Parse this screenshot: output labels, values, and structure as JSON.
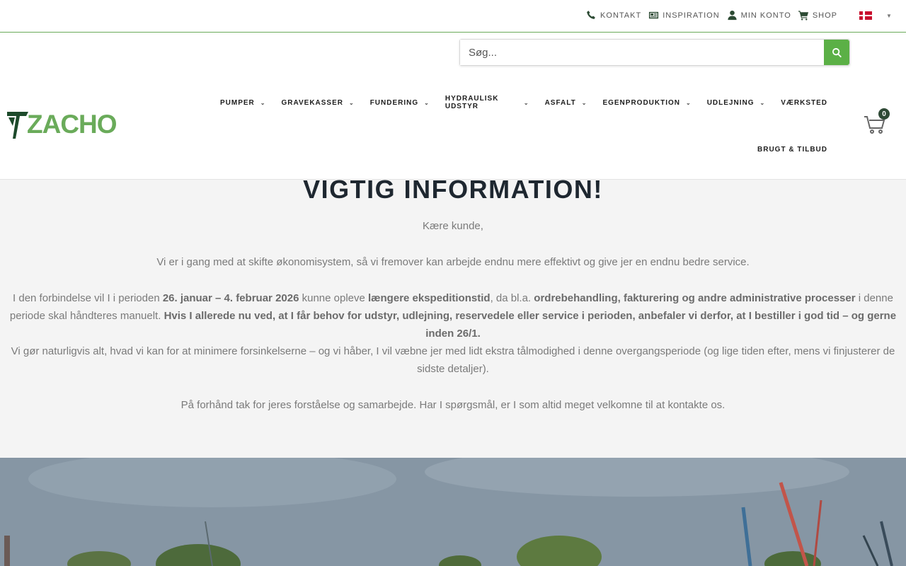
{
  "topbar": {
    "links": [
      {
        "label": "KONTAKT",
        "icon": "phone-icon"
      },
      {
        "label": "INSPIRATION",
        "icon": "newspaper-icon"
      },
      {
        "label": "MIN KONTO",
        "icon": "user-icon"
      },
      {
        "label": "SHOP",
        "icon": "cart-icon"
      }
    ],
    "language": "Danish"
  },
  "search": {
    "placeholder": "Søg..."
  },
  "logo": {
    "text": "ZACHO",
    "color": "#6aab5a"
  },
  "nav": {
    "items": [
      {
        "label": "PUMPER",
        "dropdown": true
      },
      {
        "label": "GRAVEKASSER",
        "dropdown": true
      },
      {
        "label": "FUNDERING",
        "dropdown": true
      },
      {
        "label": "HYDRAULISK UDSTYR",
        "dropdown": true
      },
      {
        "label": "ASFALT",
        "dropdown": true
      },
      {
        "label": "EGENPRODUKTION",
        "dropdown": true
      },
      {
        "label": "UDLEJNING",
        "dropdown": true
      },
      {
        "label": "VÆRKSTED",
        "dropdown": false
      },
      {
        "label": "BRUGT & TILBUD",
        "dropdown": false
      }
    ]
  },
  "cart": {
    "count": "0"
  },
  "notice": {
    "title": "VIGTIG INFORMATION!",
    "greeting": "Kære kunde,",
    "p2": "Vi er i gang med at skifte økonomisystem, så vi fremover kan arbejde endnu mere effektivt og give jer en endnu bedre service.",
    "p3a": "I den forbindelse vil I i perioden ",
    "p3b": "26. januar – 4. februar 2026",
    "p3c": " kunne opleve ",
    "p3d": "længere ekspeditionstid",
    "p3e": ", da bl.a. ",
    "p3f": "ordrebehandling, fakturering og andre administrative processer",
    "p3g": " i denne periode skal håndteres manuelt. ",
    "p3h": "Hvis I allerede nu ved, at I får behov for udstyr, udlejning, reservedele eller service i perioden, anbefaler vi derfor, at I bestiller i god tid – og gerne inden 26/1.",
    "p4": "Vi gør naturligvis alt, hvad vi kan for at minimere forsinkelserne – og vi håber, I vil væbne jer med lidt ekstra tålmodighed i denne overgangsperiode (og lige tiden efter, mens vi finjusterer de sidste detaljer).",
    "p5": "På forhånd tak for jeres forståelse og samarbejde. Har I spørgsmål, er I som altid meget velkomne til at kontakte os."
  },
  "colors": {
    "accent": "#5bb046",
    "dark": "#2f4a36",
    "text": "#7a7a7a"
  }
}
